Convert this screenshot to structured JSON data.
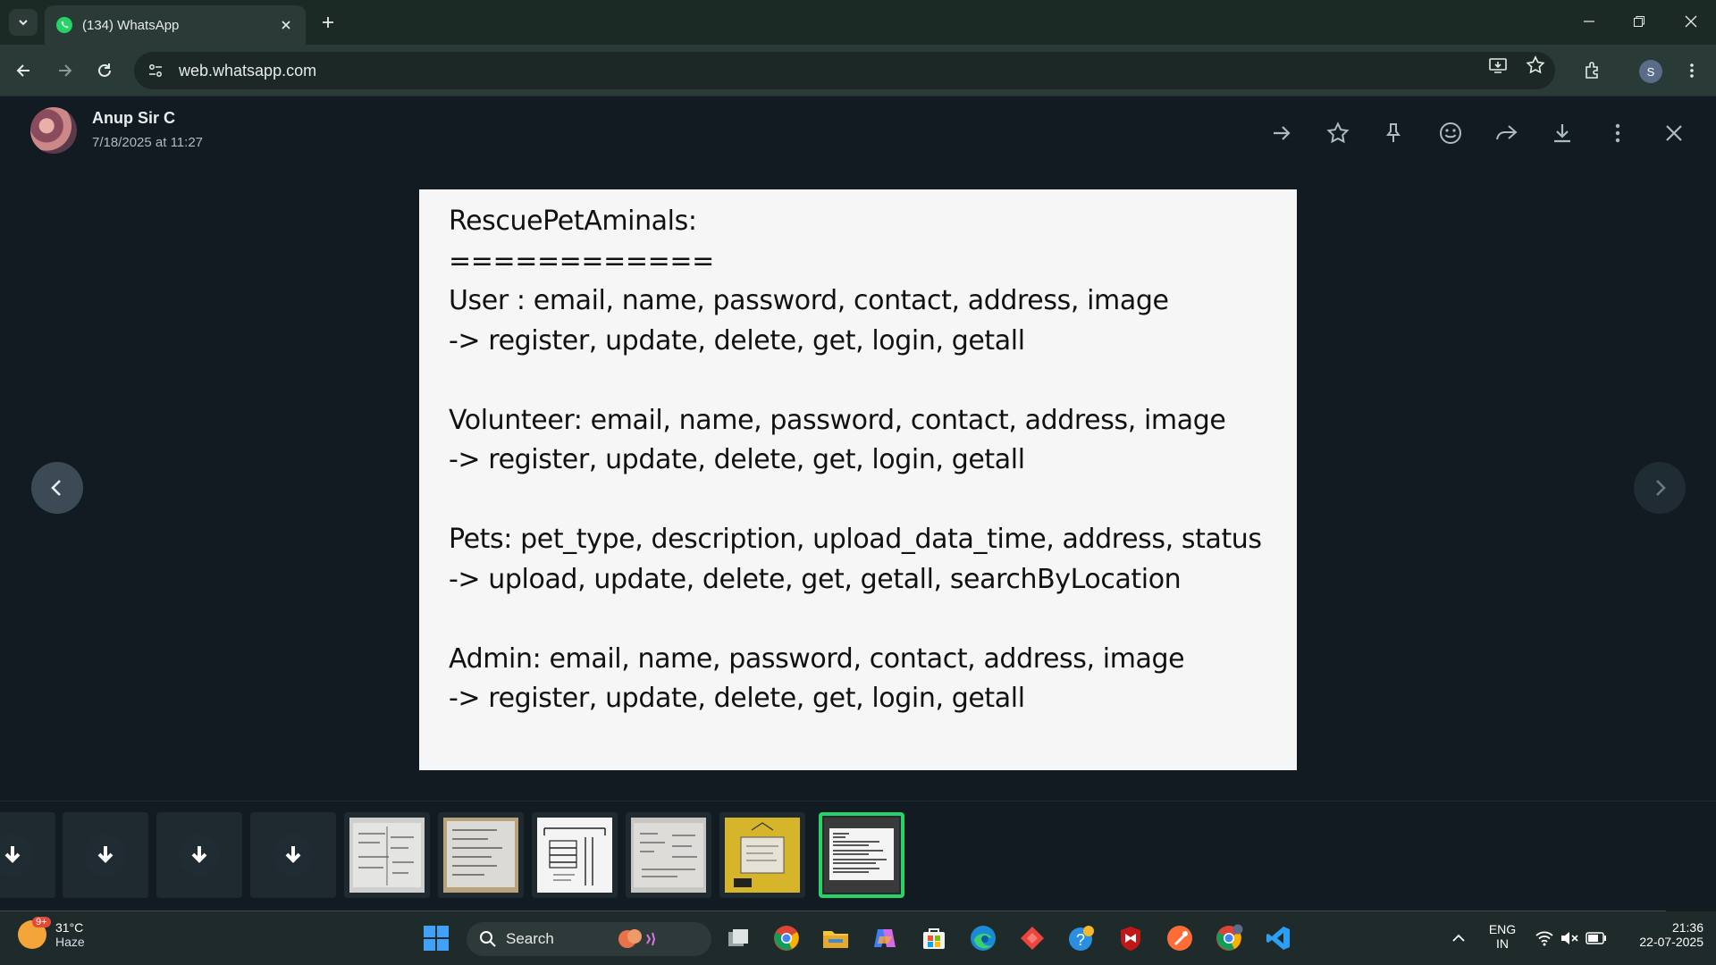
{
  "browser": {
    "tab_title": "(134) WhatsApp",
    "url": "web.whatsapp.com",
    "profile_initial": "S"
  },
  "viewer": {
    "sender_name": "Anup Sir C",
    "timestamp": "7/18/2025 at 11:27",
    "image_lines": [
      "RescuePetAminals:",
      "============",
      "User : email, name, password, contact, address, image",
      "-> register, update, delete, get, login, getall",
      "",
      "Volunteer: email, name, password, contact, address, image",
      "-> register, update, delete, get, login, getall",
      "",
      "Pets: pet_type, description, upload_data_time, address, status",
      "-> upload, update, delete, get, getall, searchByLocation",
      "",
      "Admin: email, name, password, contact, address, image",
      "-> register, update, delete, get, login, getall"
    ]
  },
  "taskbar": {
    "temperature": "31°C",
    "weather": "Haze",
    "weather_badge": "9+",
    "search_label": "Search",
    "chrome_badge": "S",
    "lang_line1": "ENG",
    "lang_line2": "IN",
    "time": "21:36",
    "date": "22-07-2025"
  },
  "colors": {
    "accent": "#25d366",
    "background": "#111b21"
  }
}
